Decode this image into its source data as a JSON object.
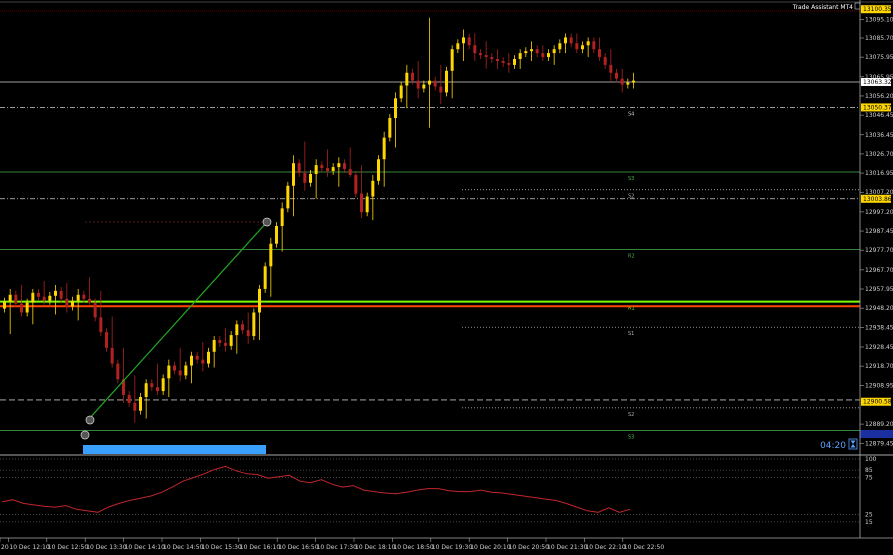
{
  "window": {
    "indicator_title": "Trade Assistant MT4",
    "timer": "04:20"
  },
  "main_chart": {
    "price_min": 12875,
    "price_max": 13103,
    "price_axis_labels": [
      "13095.10",
      "13085.70",
      "13075.95",
      "13065.95",
      "13056.20",
      "13046.45",
      "13036.45",
      "13026.70",
      "13016.95",
      "13007.20",
      "12997.20",
      "12987.45",
      "12977.70",
      "12967.70",
      "12957.95",
      "12948.20",
      "12938.45",
      "12928.45",
      "12918.70",
      "12908.95",
      "12889.20",
      "12879.45"
    ],
    "price_tags": [
      {
        "label": "13100.35",
        "price": 13100.35,
        "bg": "#ffd700",
        "fg": "#000000"
      },
      {
        "label": "13063.32",
        "price": 13063.32,
        "bg": "#ffffff",
        "fg": "#000000"
      },
      {
        "label": "13050.37",
        "price": 13050.37,
        "bg": "#ffd700",
        "fg": "#000000"
      },
      {
        "label": "13003.86",
        "price": 13003.86,
        "bg": "#ffd700",
        "fg": "#000000"
      },
      {
        "label": "12900.58",
        "price": 12900.58,
        "bg": "#ffd700",
        "fg": "#000000"
      }
    ],
    "level_lines": [
      {
        "price": 13063.3,
        "color": "#cfcfcf",
        "style": "solid",
        "label": ""
      },
      {
        "price": 13050.4,
        "color": "#d0d0d0",
        "style": "dashdot",
        "label": "S4"
      },
      {
        "price": 13017.5,
        "color": "#4caf50",
        "style": "solid",
        "label": "S3"
      },
      {
        "price": 13008.5,
        "color": "#b0b0b0",
        "style": "dotted",
        "label": "S2"
      },
      {
        "price": 13003.9,
        "color": "#d0d0d0",
        "style": "dashdot",
        "label": ""
      },
      {
        "price": 12978.0,
        "color": "#4caf50",
        "style": "solid",
        "label": "R2"
      },
      {
        "price": 12951.5,
        "color": "#7cfc00",
        "style": "solid",
        "label": "R1"
      },
      {
        "price": 12949.2,
        "color": "#ff4500",
        "style": "solid",
        "label": ""
      },
      {
        "price": 12938.5,
        "color": "#b0b0b0",
        "style": "dotted",
        "label": "S1"
      },
      {
        "price": 12901.5,
        "color": "#c0c0c0",
        "style": "dashed",
        "label": ""
      },
      {
        "price": 12897.5,
        "color": "#b0b0b0",
        "style": "dotted",
        "label": "S2"
      },
      {
        "price": 12886.0,
        "color": "#4caf50",
        "style": "solid",
        "label": "S3"
      }
    ]
  },
  "rsi_panel": {
    "axis_labels": [
      "100",
      "85",
      "75",
      "25",
      "15"
    ],
    "levels": [
      100,
      85,
      75,
      25,
      15
    ],
    "values": [
      42,
      45,
      40,
      38,
      36,
      35,
      37,
      32,
      30,
      28,
      35,
      40,
      44,
      47,
      50,
      55,
      62,
      70,
      75,
      80,
      86,
      90,
      84,
      80,
      79,
      74,
      76,
      78,
      70,
      68,
      72,
      66,
      62,
      64,
      58,
      56,
      54,
      53,
      55,
      58,
      60,
      60,
      57,
      56,
      56,
      58,
      55,
      54,
      52,
      50,
      48,
      46,
      44,
      40,
      35,
      30,
      28,
      34,
      28,
      32
    ]
  },
  "time_axis": {
    "labels": [
      "20",
      "10 Dec 12:10",
      "10 Dec 12:50",
      "10 Dec 13:30",
      "10 Dec 14:10",
      "10 Dec 14:50",
      "10 Dec 15:30",
      "10 Dec 16:10",
      "10 Dec 16:50",
      "10 Dec 17:30",
      "10 Dec 18:10",
      "10 Dec 18:50",
      "10 Dec 19:30",
      "10 Dec 20:10",
      "10 Dec 20:50",
      "10 Dec 21:30",
      "10 Dec 22:10",
      "10 Dec 22:50"
    ]
  },
  "colors": {
    "background": "#000000",
    "bull_candle": "#ffd700",
    "bear_candle": "#b22222",
    "rsi_line": "#c0262c",
    "trend_line": "#22aa22",
    "timer_bar": "#3aa0ff",
    "blue_band": "#1a2fa0"
  },
  "candles_seed": [
    [
      12948,
      12958,
      12935,
      12955
    ],
    [
      12955,
      12960,
      12944,
      12946
    ],
    [
      12946,
      12958,
      12940,
      12956
    ],
    [
      12956,
      12962,
      12950,
      12952
    ],
    [
      12952,
      12960,
      12945,
      12957
    ],
    [
      12957,
      12961,
      12946,
      12949
    ],
    [
      12949,
      12958,
      12942,
      12955
    ],
    [
      12955,
      12964,
      12950,
      12951
    ],
    [
      12951,
      12957,
      12934,
      12936
    ],
    [
      12936,
      12944,
      12918,
      12920
    ],
    [
      12920,
      12928,
      12900,
      12904
    ],
    [
      12904,
      12914,
      12890,
      12896
    ],
    [
      12896,
      12912,
      12892,
      12910
    ],
    [
      12910,
      12920,
      12904,
      12906
    ],
    [
      12906,
      12922,
      12903,
      12919
    ],
    [
      12919,
      12928,
      12911,
      12914
    ],
    [
      12914,
      12926,
      12910,
      12924
    ],
    [
      12924,
      12931,
      12916,
      12920
    ],
    [
      12920,
      12934,
      12918,
      12932
    ],
    [
      12932,
      12938,
      12926,
      12929
    ],
    [
      12929,
      12942,
      12925,
      12940
    ],
    [
      12940,
      12946,
      12930,
      12934
    ],
    [
      12934,
      12960,
      12932,
      12958
    ],
    [
      12958,
      12984,
      12954,
      12981
    ],
    [
      12981,
      13002,
      12977,
      12999
    ],
    [
      12999,
      13026,
      12995,
      13022
    ],
    [
      13022,
      13033,
      13008,
      13012
    ],
    [
      13012,
      13024,
      13004,
      13021
    ],
    [
      13021,
      13029,
      13015,
      13018
    ],
    [
      13018,
      13025,
      13010,
      13022
    ],
    [
      13022,
      13030,
      13015,
      13016
    ],
    [
      13016,
      13021,
      12994,
      12997
    ],
    [
      12997,
      13016,
      12993,
      13013
    ],
    [
      13013,
      13038,
      13010,
      13035
    ],
    [
      13035,
      13058,
      13030,
      13055
    ],
    [
      13055,
      13072,
      13050,
      13068
    ],
    [
      13068,
      13074,
      13055,
      13060
    ],
    [
      13060,
      13096,
      13040,
      13064
    ],
    [
      13064,
      13072,
      13052,
      13058
    ],
    [
      13058,
      13082,
      13055,
      13080
    ],
    [
      13080,
      13090,
      13074,
      13086
    ],
    [
      13086,
      13088,
      13074,
      13078
    ],
    [
      13078,
      13084,
      13070,
      13076
    ],
    [
      13076,
      13080,
      13070,
      13074
    ],
    [
      13074,
      13078,
      13068,
      13072
    ],
    [
      13072,
      13080,
      13070,
      13078
    ],
    [
      13078,
      13084,
      13074,
      13080
    ],
    [
      13080,
      13082,
      13074,
      13076
    ],
    [
      13076,
      13082,
      13072,
      13080
    ],
    [
      13080,
      13088,
      13078,
      13086
    ],
    [
      13086,
      13088,
      13078,
      13080
    ],
    [
      13080,
      13086,
      13076,
      13084
    ],
    [
      13084,
      13086,
      13074,
      13076
    ],
    [
      13076,
      13080,
      13064,
      13068
    ],
    [
      13068,
      13070,
      13058,
      13062
    ],
    [
      13062,
      13068,
      13060,
      13064
    ]
  ]
}
